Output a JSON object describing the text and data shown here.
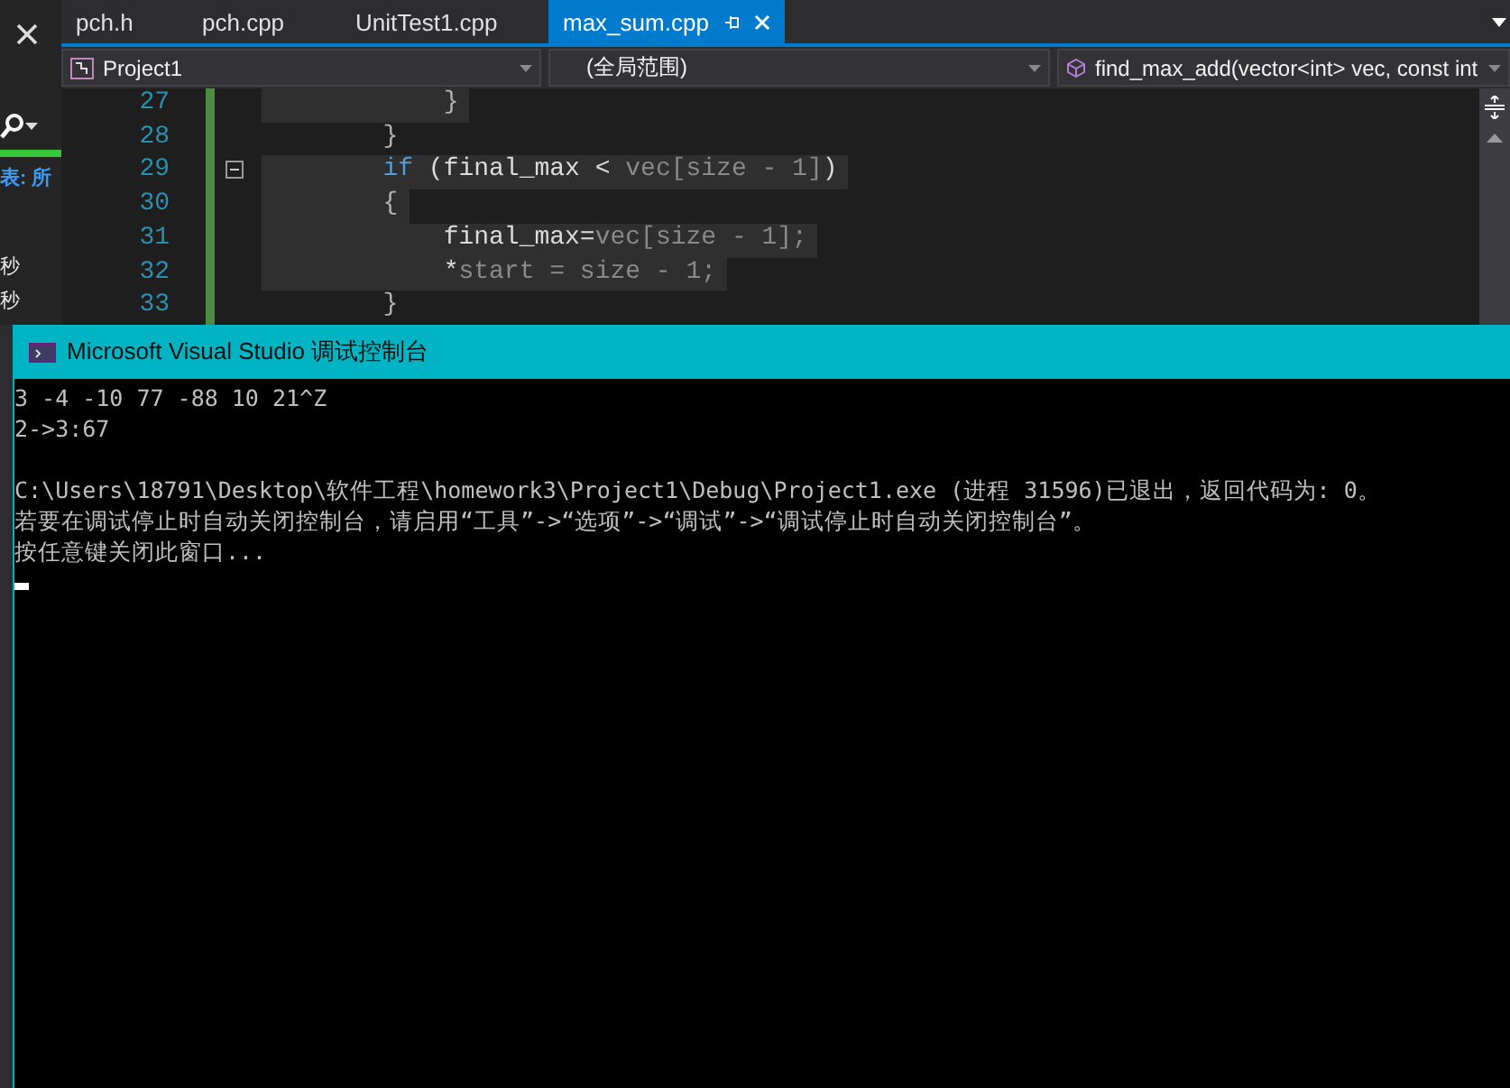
{
  "side_panel": {
    "texts": [
      "表: 所",
      "秒",
      "秒"
    ]
  },
  "tabs": [
    {
      "label": "pch.h",
      "selected": false
    },
    {
      "label": "pch.cpp",
      "selected": false
    },
    {
      "label": "UnitTest1.cpp",
      "selected": false
    },
    {
      "label": "max_sum.cpp",
      "selected": true
    }
  ],
  "nav_bar": {
    "project": "Project1",
    "scope": "(全局范围)",
    "member": "find_max_add(vector<int> vec, const int"
  },
  "code_lines": [
    {
      "number": "27",
      "tokens": [
        {
          "kind": "punct",
          "text": "            }"
        }
      ],
      "highlighted": true
    },
    {
      "number": "28",
      "tokens": [
        {
          "kind": "punct",
          "text": "        }"
        }
      ],
      "highlighted": false
    },
    {
      "number": "29",
      "tokens": [
        {
          "kind": "keyword",
          "text": "        if"
        },
        {
          "kind": "plain",
          "text": " (final_max < "
        },
        {
          "kind": "dim",
          "text": "vec[size - 1]"
        },
        {
          "kind": "plain",
          "text": ")"
        }
      ],
      "highlighted": true
    },
    {
      "number": "30",
      "tokens": [
        {
          "kind": "punct",
          "text": "        {"
        }
      ],
      "highlighted": true
    },
    {
      "number": "31",
      "tokens": [
        {
          "kind": "plain",
          "text": "            final_max="
        },
        {
          "kind": "dim",
          "text": "vec[size - 1];"
        }
      ],
      "highlighted": true
    },
    {
      "number": "32",
      "tokens": [
        {
          "kind": "plain",
          "text": "            *"
        },
        {
          "kind": "dim",
          "text": "start = size - 1;"
        }
      ],
      "highlighted": true
    },
    {
      "number": "33",
      "tokens": [
        {
          "kind": "punct",
          "text": "        }"
        }
      ],
      "highlighted": false
    }
  ],
  "console": {
    "title": "Microsoft Visual Studio 调试控制台",
    "program_output": [
      "3 -4 -10 77 -88 10 21^Z",
      "2->3:67"
    ],
    "lines": [
      "C:\\Users\\18791\\Desktop\\软件工程\\homework3\\Project1\\Debug\\Project1.exe (进程 31596)已退出，返回代码为: 0。",
      "若要在调试停止时自动关闭控制台，请启用“工具”->“选项”->“调试”->“调试停止时自动关闭控制台”。",
      "按任意键关闭此窗口..."
    ]
  }
}
